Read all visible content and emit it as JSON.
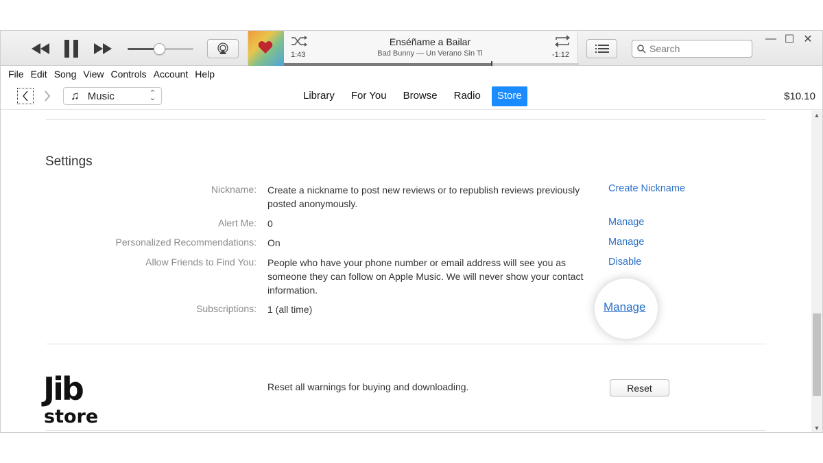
{
  "player": {
    "now_playing": {
      "title": "Enséñame a Bailar",
      "subtitle": "Bad Bunny — Un Verano Sin Ti",
      "elapsed": "1:43",
      "remaining": "-1:12",
      "progress": 0.705
    },
    "volume": 0.48
  },
  "search": {
    "placeholder": "Search"
  },
  "window_controls": {
    "minimize": "—",
    "maximize": "☐",
    "close": "✕"
  },
  "menu": [
    "File",
    "Edit",
    "Song",
    "View",
    "Controls",
    "Account",
    "Help"
  ],
  "nav": {
    "media_kind": "Music",
    "tabs": [
      {
        "label": "Library",
        "active": false
      },
      {
        "label": "For You",
        "active": false
      },
      {
        "label": "Browse",
        "active": false
      },
      {
        "label": "Radio",
        "active": false
      },
      {
        "label": "Store",
        "active": true
      }
    ],
    "balance": "$10.10"
  },
  "settings": {
    "title": "Settings",
    "rows": [
      {
        "label": "Nickname:",
        "value": "Create a nickname to post new reviews or to republish reviews previously posted anonymously.",
        "action": "Create Nickname"
      },
      {
        "label": "Alert Me:",
        "value": "0",
        "action": "Manage"
      },
      {
        "label": "Personalized Recommendations:",
        "value": "On",
        "action": "Manage"
      },
      {
        "label": "Allow Friends to Find You:",
        "value": "People who have your phone number or email address will see you as someone they can follow on Apple Music. We will never show your contact information.",
        "action": "Disable"
      },
      {
        "label": "Subscriptions:",
        "value": "1 (all time)",
        "action": "Manage"
      }
    ],
    "reset": {
      "text": "Reset all warnings for buying and downloading.",
      "button": "Reset"
    }
  },
  "watermark": {
    "line1": "Jib",
    "line2": "store"
  },
  "colors": {
    "accent": "#1a8cff",
    "link": "#2a70c8"
  }
}
